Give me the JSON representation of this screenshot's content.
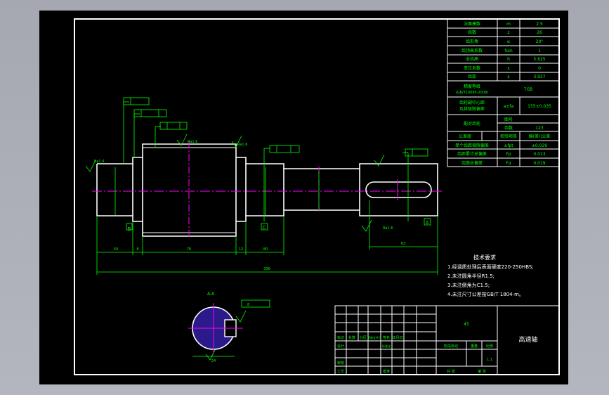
{
  "params_table": {
    "rows": [
      {
        "label": "法面模数",
        "sym": "m",
        "val": "2.5"
      },
      {
        "label": "齿数",
        "sym": "z",
        "val": "26"
      },
      {
        "label": "齿形角",
        "sym": "α",
        "val": "20°"
      },
      {
        "label": "齿顶高系数",
        "sym": "han",
        "val": "1"
      },
      {
        "label": "全齿高",
        "sym": "h",
        "val": "5.625"
      },
      {
        "label": "变位系数",
        "sym": "x",
        "val": "0"
      },
      {
        "label": "齿厚",
        "sym": "s",
        "val": "3.927"
      }
    ],
    "grade_label": "精度等级",
    "grade_std": "(GB/T10095-2008)",
    "grade_val": "7GB",
    "center_label_1": "齿轮副中心距",
    "center_label_2": "及其极限偏差",
    "center_sym": "a±fa",
    "center_val": "155±0.035",
    "mate_label": "配对齿轮",
    "drawing_no_label": "图号",
    "teeth_label": "齿数",
    "teeth_val": "123",
    "tol_group": "公差组",
    "check_item": "检验项目",
    "check_val": "偏(差)|公差",
    "single_pitch": "单个齿距极限偏差",
    "single_pitch_sym": "±fpt",
    "single_pitch_val": "±0.029",
    "cum_pitch": "齿距累计总偏差",
    "cum_pitch_sym": "Fp",
    "cum_pitch_val": "0.013",
    "profile_dev": "齿廓总偏差",
    "profile_sym": "Fα",
    "profile_val": "0.019"
  },
  "tech_req": {
    "title": "技术要求",
    "lines": [
      "1.经调质处理后表面硬度220-250HBS;",
      "2.未注圆角半径R1.5;",
      "3.未注倒角为C1.5;",
      "4.未注尺寸公差按GB/T 1804-m。"
    ]
  },
  "dimensions": {
    "overall": "336",
    "seg1": "50",
    "seg2": "8",
    "seg3": "76",
    "seg4": "12",
    "seg5": "80",
    "key_dim": "63",
    "ra": "Ra1.6",
    "datum_b": "B",
    "datum_c": "C",
    "datum_a": "A",
    "section_label": "A-A",
    "section_dim": "24",
    "section_width": "8"
  },
  "title_block": {
    "part_name": "高速轴",
    "material": "45",
    "scale": "1:1",
    "row_labels": [
      "标记",
      "处数",
      "分区",
      "更改文件号",
      "签名",
      "年月日"
    ],
    "design": "设计",
    "std": "标准化",
    "review": "审核",
    "craft": "工艺",
    "approve": "批准",
    "stage": "阶段标记",
    "weight": "重量",
    "ratio": "比例",
    "sheets": "共  张",
    "sheet_of": "第  张"
  },
  "colors": {
    "outline": "#ffffff",
    "dim": "#00ff00",
    "center": "#ff00ff",
    "frame": "#ffffff",
    "hatch": "#5a3cff"
  }
}
